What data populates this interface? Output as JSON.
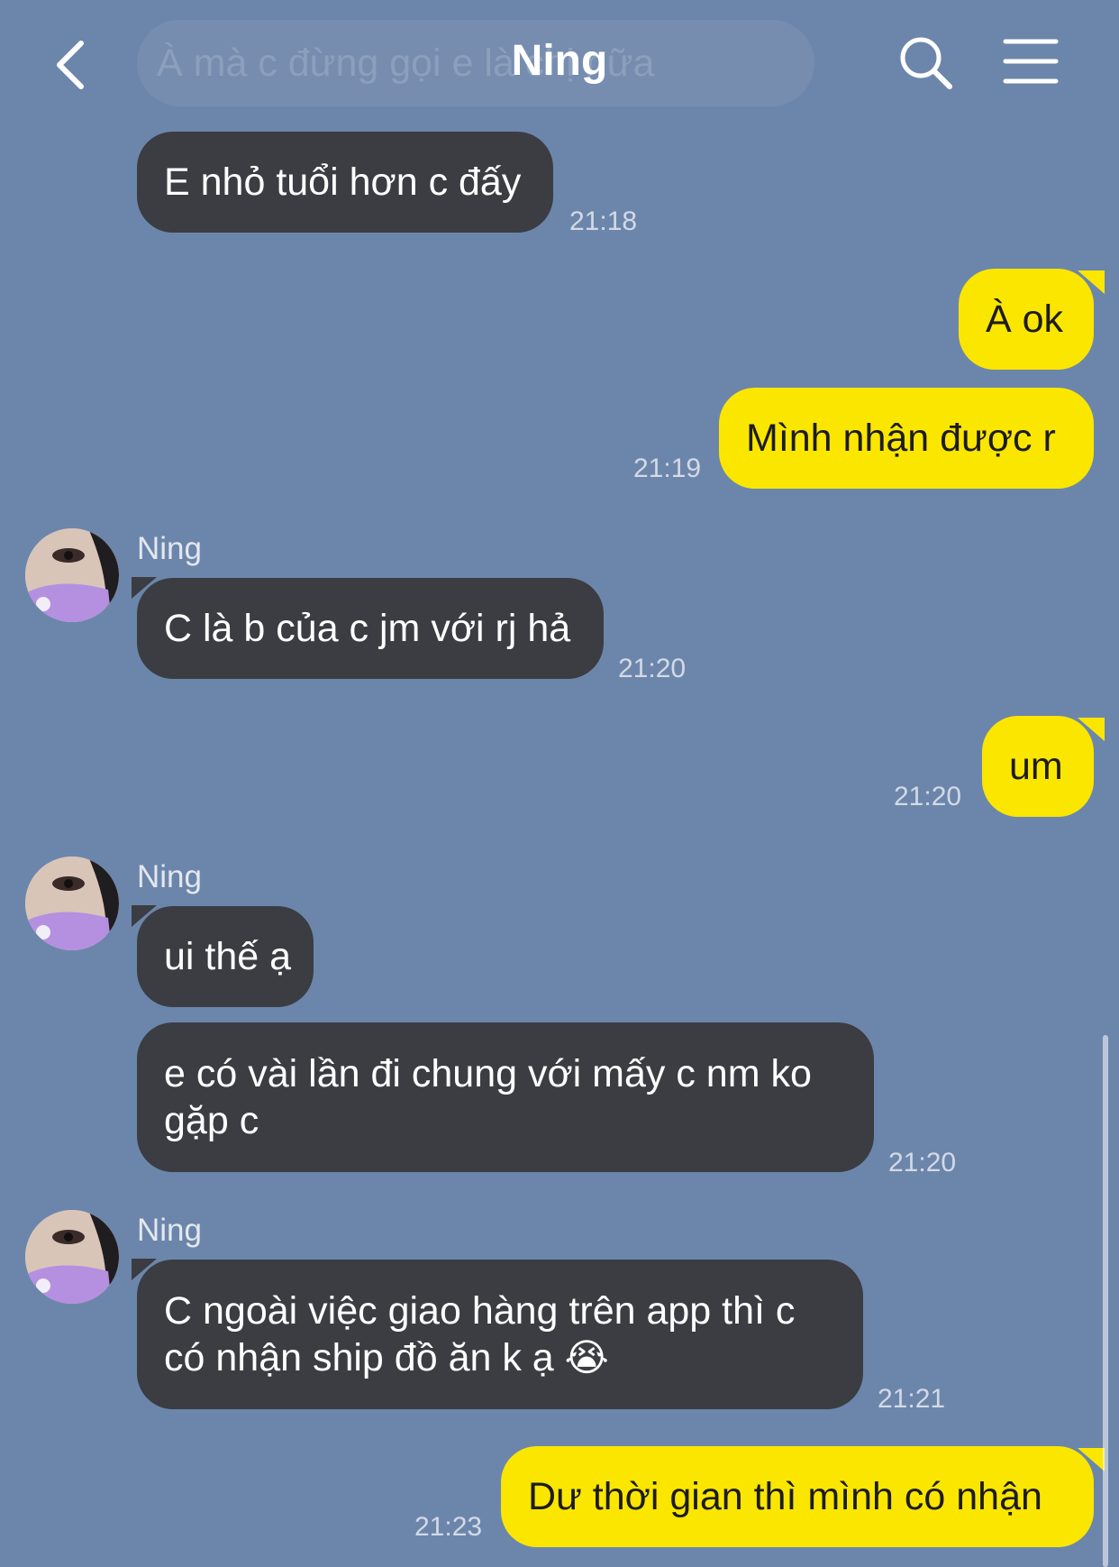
{
  "header": {
    "title": "Ning",
    "preview_text": "À mà c đừng gọi e là chị nữa",
    "back_icon": "chevron-left-icon",
    "search_icon": "search-icon",
    "menu_icon": "hamburger-menu-icon"
  },
  "colors": {
    "background": "#6c86ab",
    "incoming_bubble": "#3b3d43",
    "outgoing_bubble": "#fbe600"
  },
  "messages": [
    {
      "direction": "in",
      "text": "E nhỏ tuổi hơn c đấy",
      "time": "21:18"
    },
    {
      "direction": "out",
      "text": "À ok"
    },
    {
      "direction": "out",
      "text": "Mình nhận được r",
      "time": "21:19"
    },
    {
      "direction": "in",
      "sender": "Ning",
      "text": "C là b của c jm với rj hả",
      "time": "21:20"
    },
    {
      "direction": "out",
      "text": "um",
      "time": "21:20"
    },
    {
      "direction": "in",
      "sender": "Ning",
      "text": "ui thế ạ"
    },
    {
      "direction": "in",
      "text": "e có vài lần đi chung với mấy c nm ko gặp c",
      "time": "21:20"
    },
    {
      "direction": "in",
      "sender": "Ning",
      "text": "C ngoài việc giao hàng trên app thì c có nhận ship đồ ăn k ạ",
      "emoji": "😭",
      "time": "21:21"
    },
    {
      "direction": "out",
      "text": "Dư thời gian thì mình có nhận",
      "time": "21:23"
    }
  ]
}
